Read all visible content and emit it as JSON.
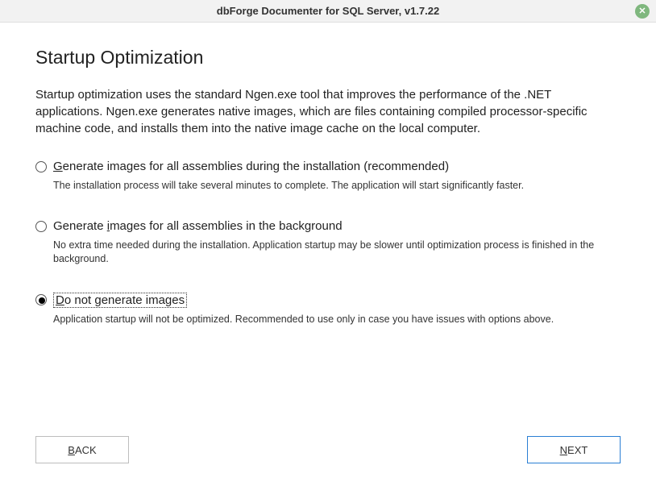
{
  "window": {
    "title": "dbForge Documenter for SQL Server, v1.7.22"
  },
  "page": {
    "heading": "Startup Optimization",
    "intro": "Startup optimization uses the standard Ngen.exe tool that improves the performance of the .NET applications. Ngen.exe generates native images, which are files containing compiled processor-specific machine code, and installs them into the native image cache on the local computer."
  },
  "options": [
    {
      "label_pre": "",
      "label_u": "G",
      "label_post": "enerate images for all assemblies during the installation (recommended)",
      "desc": "The installation process will take several minutes to complete. The application will start significantly faster.",
      "selected": false,
      "focused": false
    },
    {
      "label_pre": "Generate ",
      "label_u": "i",
      "label_post": "mages for all assemblies in the background",
      "desc": "No extra time needed during the installation. Application startup may be slower until optimization process is finished in the background.",
      "selected": false,
      "focused": false
    },
    {
      "label_pre": "",
      "label_u": "D",
      "label_post": "o not generate images",
      "desc": "Application startup will not be optimized. Recommended to use only in case you have issues with options above.",
      "selected": true,
      "focused": true
    }
  ],
  "buttons": {
    "back_u": "B",
    "back_rest": "ACK",
    "next_u": "N",
    "next_rest": "EXT"
  }
}
